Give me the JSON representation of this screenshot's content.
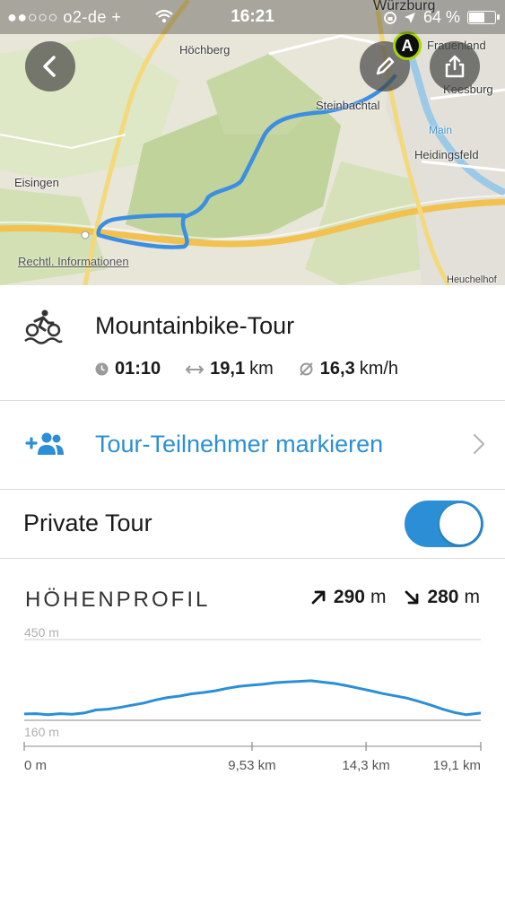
{
  "status_bar": {
    "carrier": "●●○○○ o2-de",
    "network": "+",
    "time": "16:21",
    "battery_text": "64 %",
    "battery_level": 0.64
  },
  "map": {
    "labels": {
      "hoechberg": "Höchberg",
      "steinbachtal": "Steinbachtal",
      "frauenland": "Frauenland",
      "keesburg": "Keesburg",
      "heidingsfeld": "Heidingsfeld",
      "eisingen": "Eisingen",
      "main": "Main",
      "wuerzburg": "Würzburg",
      "heuchelhof": "Heuchelhof"
    },
    "legal_link": "Rechtl. Informationen",
    "end_marker": "A",
    "icons": {
      "back": "chevron-left-icon",
      "edit": "pencil-icon",
      "share": "share-icon"
    },
    "colors": {
      "route": "#3b8ee0",
      "marker_ring": "#a7d600"
    }
  },
  "tour": {
    "title": "Mountainbike-Tour",
    "sport_icon": "mountainbike-icon",
    "duration": "01:10",
    "distance_value": "19,1",
    "distance_unit": "km",
    "speed_value": "16,3",
    "speed_unit": "km/h"
  },
  "participants": {
    "label": "Tour-Teilnehmer markieren",
    "icon": "add-person-icon"
  },
  "privacy": {
    "label": "Private Tour",
    "enabled": true
  },
  "elevation": {
    "title": "HÖHENPROFIL",
    "ascent_value": "290",
    "ascent_unit": "m",
    "descent_value": "280",
    "descent_unit": "m"
  },
  "colors": {
    "accent": "#2c8fd6",
    "divider": "#dcdcdc"
  },
  "chart_data": {
    "type": "area",
    "title": "HÖHENPROFIL",
    "ylim": [
      160,
      450
    ],
    "y_labels": [
      "450 m",
      "160 m"
    ],
    "xlim": [
      0,
      19.1
    ],
    "x_tick_labels": [
      "0 m",
      "9,53 km",
      "14,3 km",
      "19,1 km"
    ],
    "x_ticks": [
      0,
      9.53,
      14.3,
      19.1
    ],
    "x": [
      0,
      0.5,
      1.0,
      1.5,
      2.0,
      2.5,
      3.0,
      3.5,
      4.0,
      4.5,
      5.0,
      5.5,
      6.0,
      6.5,
      7.0,
      7.5,
      8.0,
      8.5,
      9.0,
      9.5,
      10.0,
      10.5,
      11.0,
      11.5,
      12.0,
      12.5,
      13.0,
      13.5,
      14.0,
      14.5,
      15.0,
      15.5,
      16.0,
      16.5,
      17.0,
      17.5,
      18.0,
      18.5,
      19.1
    ],
    "y": [
      183,
      184,
      180,
      184,
      182,
      186,
      197,
      200,
      206,
      214,
      222,
      233,
      242,
      247,
      255,
      260,
      266,
      275,
      282,
      286,
      290,
      295,
      298,
      300,
      302,
      297,
      292,
      284,
      275,
      266,
      256,
      248,
      240,
      228,
      215,
      200,
      188,
      180,
      186
    ]
  }
}
